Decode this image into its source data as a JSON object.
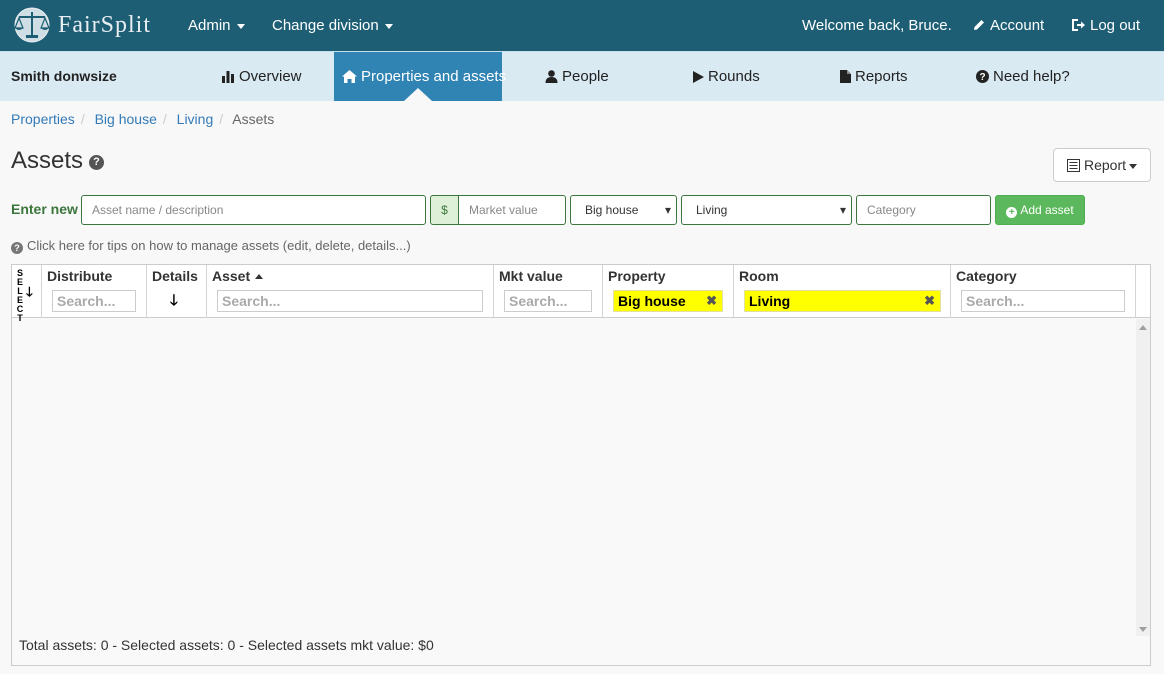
{
  "topbar": {
    "brand": "FairSplit",
    "admin_label": "Admin",
    "change_division_label": "Change division",
    "welcome": "Welcome back, Bruce.",
    "account_label": "Account",
    "logout_label": "Log out",
    "background_color": "#1d5e75"
  },
  "subnav": {
    "division_name": "Smith donwsize",
    "items": [
      {
        "label": "Overview",
        "icon": "bar-chart-icon"
      },
      {
        "label": "Properties and assets",
        "icon": "home-icon",
        "active": true
      },
      {
        "label": "People",
        "icon": "user-icon"
      },
      {
        "label": "Rounds",
        "icon": "play-icon"
      },
      {
        "label": "Reports",
        "icon": "file-icon"
      },
      {
        "label": "Need help?",
        "icon": "question-circle-icon"
      }
    ],
    "active_color": "#2f84b4"
  },
  "breadcrumb": {
    "items": [
      "Properties",
      "Big house",
      "Living"
    ],
    "current": "Assets"
  },
  "page": {
    "title": "Assets",
    "report_label": "Report"
  },
  "enter_new": {
    "label": "Enter new",
    "asset_placeholder": "Asset name / description",
    "currency_symbol": "$",
    "market_value_placeholder": "Market value",
    "property_selected": "Big house",
    "room_selected": "Living",
    "category_placeholder": "Category",
    "add_label": "Add asset"
  },
  "tips": "Click here for tips on how to manage assets (edit, delete, details...)",
  "grid": {
    "select_label": "SELECT",
    "columns": {
      "distribute": "Distribute",
      "details": "Details",
      "asset": "Asset",
      "mkt_value": "Mkt value",
      "property": "Property",
      "room": "Room",
      "category": "Category"
    },
    "search_placeholder": "Search...",
    "property_filter": "Big house",
    "room_filter": "Living",
    "filter_highlight_color": "#ffff00",
    "footer": "Total assets: 0 - Selected assets: 0 - Selected assets mkt value: $0"
  }
}
